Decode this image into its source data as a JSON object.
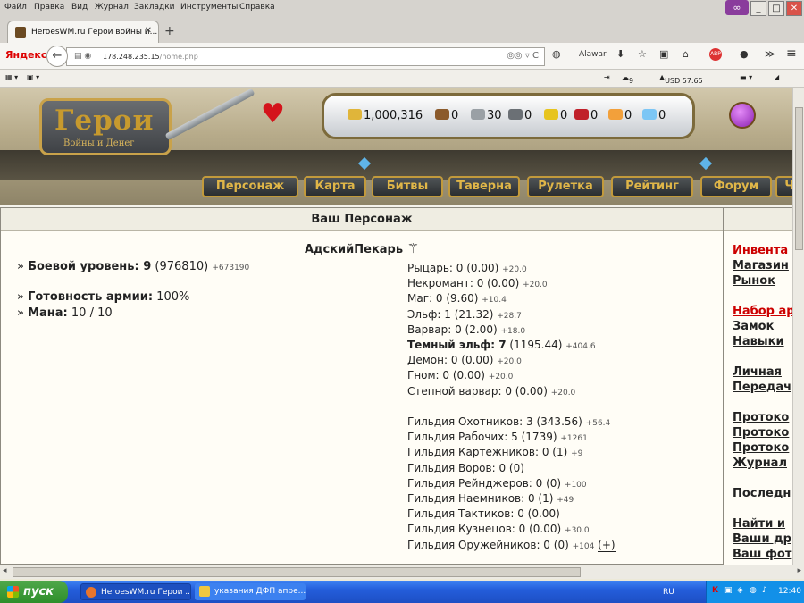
{
  "browser": {
    "menu": [
      "Файл",
      "Правка",
      "Вид",
      "Журнал",
      "Закладки",
      "Инструменты",
      "Справка"
    ],
    "tab_title": "HeroesWM.ru Герои войны и...",
    "yandex": "Яндекс",
    "url_host": "178.248.235.15",
    "url_path": "/home.php",
    "alawar": "Alawar",
    "bookmarks": {
      "weather": "9",
      "currency": "USD 57.65"
    }
  },
  "game": {
    "logo_title": "Герои",
    "logo_subtitle": "Войны и Денег",
    "resources": [
      {
        "value": "1,000,316",
        "color": "#e0b53a"
      },
      {
        "value": "0",
        "color": "#8b5a2b"
      },
      {
        "value": "30",
        "color": "#9aa0a5"
      },
      {
        "value": "0",
        "color": "#6b7075"
      },
      {
        "value": "0",
        "color": "#e7c41e"
      },
      {
        "value": "0",
        "color": "#c0202a"
      },
      {
        "value": "0",
        "color": "#f2a03b"
      },
      {
        "value": "0",
        "color": "#7cc6f5"
      }
    ],
    "menu": [
      "Персонаж",
      "Карта",
      "Битвы",
      "Таверна",
      "Рулетка",
      "Рейтинг",
      "Форум",
      "Ча"
    ],
    "panel_title": "Ваш Персонаж",
    "char_name": "АдскийПекарь",
    "combat_label": "Боевой уровень: 9",
    "combat_value": "(976810)",
    "combat_extra": "+673190",
    "army_label": "Готовность армии:",
    "army_value": "100%",
    "mana_label": "Мана:",
    "mana_value": "10 / 10",
    "factions": [
      {
        "text": "Рыцарь: 0 (0.00)",
        "extra": "+20.0",
        "bold": false
      },
      {
        "text": "Некромант: 0 (0.00)",
        "extra": "+20.0",
        "bold": false
      },
      {
        "text": "Маг: 0 (9.60)",
        "extra": "+10.4",
        "bold": false
      },
      {
        "text": "Эльф: 1 (21.32)",
        "extra": "+28.7",
        "bold": false
      },
      {
        "text": "Варвар: 0 (2.00)",
        "extra": "+18.0",
        "bold": false
      },
      {
        "text_bold": "Темный эльф: 7",
        "text": " (1195.44)",
        "extra": "+404.6",
        "bold": true
      },
      {
        "text": "Демон: 0 (0.00)",
        "extra": "+20.0",
        "bold": false
      },
      {
        "text": "Гном: 0 (0.00)",
        "extra": "+20.0",
        "bold": false
      },
      {
        "text": "Степной варвар: 0 (0.00)",
        "extra": "+20.0",
        "bold": false
      }
    ],
    "guilds": [
      {
        "text": "Гильдия Охотников: 3 (343.56)",
        "extra": "+56.4"
      },
      {
        "text": "Гильдия Рабочих: 5 (1739)",
        "extra": "+1261"
      },
      {
        "text": "Гильдия Картежников: 0 (1)",
        "extra": "+9"
      },
      {
        "text": "Гильдия Воров: 0 (0)",
        "extra": ""
      },
      {
        "text": "Гильдия Рейнджеров: 0 (0)",
        "extra": "+100"
      },
      {
        "text": "Гильдия Наемников: 0 (1)",
        "extra": "+49"
      },
      {
        "text": "Гильдия Тактиков: 0 (0.00)",
        "extra": ""
      },
      {
        "text": "Гильдия Кузнецов: 0 (0.00)",
        "extra": "+30.0"
      },
      {
        "text": "Гильдия Оружейников: 0 (0)",
        "extra": "+104",
        "plus": "(+)"
      }
    ],
    "sidebar": [
      {
        "label": "Инвента",
        "red": true
      },
      {
        "label": "Магазин",
        "red": false
      },
      {
        "label": "Рынок",
        "red": false
      },
      {
        "label": "Набор ар",
        "red": true
      },
      {
        "label": "Замок",
        "red": false
      },
      {
        "label": "Навыки",
        "red": false
      },
      {
        "label": "Личная",
        "red": false
      },
      {
        "label": "Передач",
        "red": false
      },
      {
        "label": "Протоко",
        "red": false
      },
      {
        "label": "Протоко",
        "red": false
      },
      {
        "label": "Протоко",
        "red": false
      },
      {
        "label": "Журнал",
        "red": false
      },
      {
        "label": "Последн",
        "red": false
      },
      {
        "label": "Найти и",
        "red": false
      },
      {
        "label": "Ваши др",
        "red": false
      },
      {
        "label": "Ваш фот",
        "red": false
      }
    ]
  },
  "taskbar": {
    "start": "пуск",
    "tasks": [
      "HeroesWM.ru Герои ...",
      "указания ДФП апре..."
    ],
    "lang": "RU",
    "time": "12:40"
  }
}
